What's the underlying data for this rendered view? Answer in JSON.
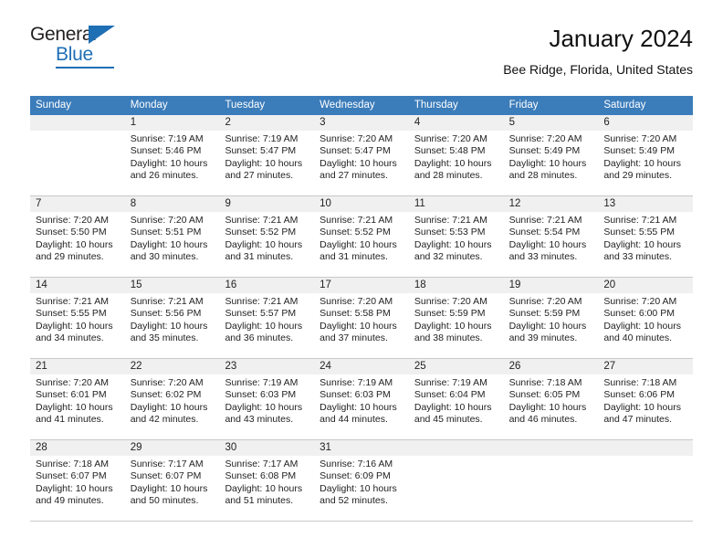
{
  "logo": {
    "word1": "General",
    "word2": "Blue",
    "triangle_color": "#1f6fb5"
  },
  "header": {
    "title": "January 2024",
    "subtitle": "Bee Ridge, Florida, United States",
    "accent_color": "#3b7cba"
  },
  "weekdays": [
    "Sunday",
    "Monday",
    "Tuesday",
    "Wednesday",
    "Thursday",
    "Friday",
    "Saturday"
  ],
  "weeks": [
    [
      {
        "day": "",
        "lines": []
      },
      {
        "day": "1",
        "lines": [
          "Sunrise: 7:19 AM",
          "Sunset: 5:46 PM",
          "Daylight: 10 hours",
          "and 26 minutes."
        ]
      },
      {
        "day": "2",
        "lines": [
          "Sunrise: 7:19 AM",
          "Sunset: 5:47 PM",
          "Daylight: 10 hours",
          "and 27 minutes."
        ]
      },
      {
        "day": "3",
        "lines": [
          "Sunrise: 7:20 AM",
          "Sunset: 5:47 PM",
          "Daylight: 10 hours",
          "and 27 minutes."
        ]
      },
      {
        "day": "4",
        "lines": [
          "Sunrise: 7:20 AM",
          "Sunset: 5:48 PM",
          "Daylight: 10 hours",
          "and 28 minutes."
        ]
      },
      {
        "day": "5",
        "lines": [
          "Sunrise: 7:20 AM",
          "Sunset: 5:49 PM",
          "Daylight: 10 hours",
          "and 28 minutes."
        ]
      },
      {
        "day": "6",
        "lines": [
          "Sunrise: 7:20 AM",
          "Sunset: 5:49 PM",
          "Daylight: 10 hours",
          "and 29 minutes."
        ]
      }
    ],
    [
      {
        "day": "7",
        "lines": [
          "Sunrise: 7:20 AM",
          "Sunset: 5:50 PM",
          "Daylight: 10 hours",
          "and 29 minutes."
        ]
      },
      {
        "day": "8",
        "lines": [
          "Sunrise: 7:20 AM",
          "Sunset: 5:51 PM",
          "Daylight: 10 hours",
          "and 30 minutes."
        ]
      },
      {
        "day": "9",
        "lines": [
          "Sunrise: 7:21 AM",
          "Sunset: 5:52 PM",
          "Daylight: 10 hours",
          "and 31 minutes."
        ]
      },
      {
        "day": "10",
        "lines": [
          "Sunrise: 7:21 AM",
          "Sunset: 5:52 PM",
          "Daylight: 10 hours",
          "and 31 minutes."
        ]
      },
      {
        "day": "11",
        "lines": [
          "Sunrise: 7:21 AM",
          "Sunset: 5:53 PM",
          "Daylight: 10 hours",
          "and 32 minutes."
        ]
      },
      {
        "day": "12",
        "lines": [
          "Sunrise: 7:21 AM",
          "Sunset: 5:54 PM",
          "Daylight: 10 hours",
          "and 33 minutes."
        ]
      },
      {
        "day": "13",
        "lines": [
          "Sunrise: 7:21 AM",
          "Sunset: 5:55 PM",
          "Daylight: 10 hours",
          "and 33 minutes."
        ]
      }
    ],
    [
      {
        "day": "14",
        "lines": [
          "Sunrise: 7:21 AM",
          "Sunset: 5:55 PM",
          "Daylight: 10 hours",
          "and 34 minutes."
        ]
      },
      {
        "day": "15",
        "lines": [
          "Sunrise: 7:21 AM",
          "Sunset: 5:56 PM",
          "Daylight: 10 hours",
          "and 35 minutes."
        ]
      },
      {
        "day": "16",
        "lines": [
          "Sunrise: 7:21 AM",
          "Sunset: 5:57 PM",
          "Daylight: 10 hours",
          "and 36 minutes."
        ]
      },
      {
        "day": "17",
        "lines": [
          "Sunrise: 7:20 AM",
          "Sunset: 5:58 PM",
          "Daylight: 10 hours",
          "and 37 minutes."
        ]
      },
      {
        "day": "18",
        "lines": [
          "Sunrise: 7:20 AM",
          "Sunset: 5:59 PM",
          "Daylight: 10 hours",
          "and 38 minutes."
        ]
      },
      {
        "day": "19",
        "lines": [
          "Sunrise: 7:20 AM",
          "Sunset: 5:59 PM",
          "Daylight: 10 hours",
          "and 39 minutes."
        ]
      },
      {
        "day": "20",
        "lines": [
          "Sunrise: 7:20 AM",
          "Sunset: 6:00 PM",
          "Daylight: 10 hours",
          "and 40 minutes."
        ]
      }
    ],
    [
      {
        "day": "21",
        "lines": [
          "Sunrise: 7:20 AM",
          "Sunset: 6:01 PM",
          "Daylight: 10 hours",
          "and 41 minutes."
        ]
      },
      {
        "day": "22",
        "lines": [
          "Sunrise: 7:20 AM",
          "Sunset: 6:02 PM",
          "Daylight: 10 hours",
          "and 42 minutes."
        ]
      },
      {
        "day": "23",
        "lines": [
          "Sunrise: 7:19 AM",
          "Sunset: 6:03 PM",
          "Daylight: 10 hours",
          "and 43 minutes."
        ]
      },
      {
        "day": "24",
        "lines": [
          "Sunrise: 7:19 AM",
          "Sunset: 6:03 PM",
          "Daylight: 10 hours",
          "and 44 minutes."
        ]
      },
      {
        "day": "25",
        "lines": [
          "Sunrise: 7:19 AM",
          "Sunset: 6:04 PM",
          "Daylight: 10 hours",
          "and 45 minutes."
        ]
      },
      {
        "day": "26",
        "lines": [
          "Sunrise: 7:18 AM",
          "Sunset: 6:05 PM",
          "Daylight: 10 hours",
          "and 46 minutes."
        ]
      },
      {
        "day": "27",
        "lines": [
          "Sunrise: 7:18 AM",
          "Sunset: 6:06 PM",
          "Daylight: 10 hours",
          "and 47 minutes."
        ]
      }
    ],
    [
      {
        "day": "28",
        "lines": [
          "Sunrise: 7:18 AM",
          "Sunset: 6:07 PM",
          "Daylight: 10 hours",
          "and 49 minutes."
        ]
      },
      {
        "day": "29",
        "lines": [
          "Sunrise: 7:17 AM",
          "Sunset: 6:07 PM",
          "Daylight: 10 hours",
          "and 50 minutes."
        ]
      },
      {
        "day": "30",
        "lines": [
          "Sunrise: 7:17 AM",
          "Sunset: 6:08 PM",
          "Daylight: 10 hours",
          "and 51 minutes."
        ]
      },
      {
        "day": "31",
        "lines": [
          "Sunrise: 7:16 AM",
          "Sunset: 6:09 PM",
          "Daylight: 10 hours",
          "and 52 minutes."
        ]
      },
      {
        "day": "",
        "lines": []
      },
      {
        "day": "",
        "lines": []
      },
      {
        "day": "",
        "lines": []
      }
    ]
  ]
}
